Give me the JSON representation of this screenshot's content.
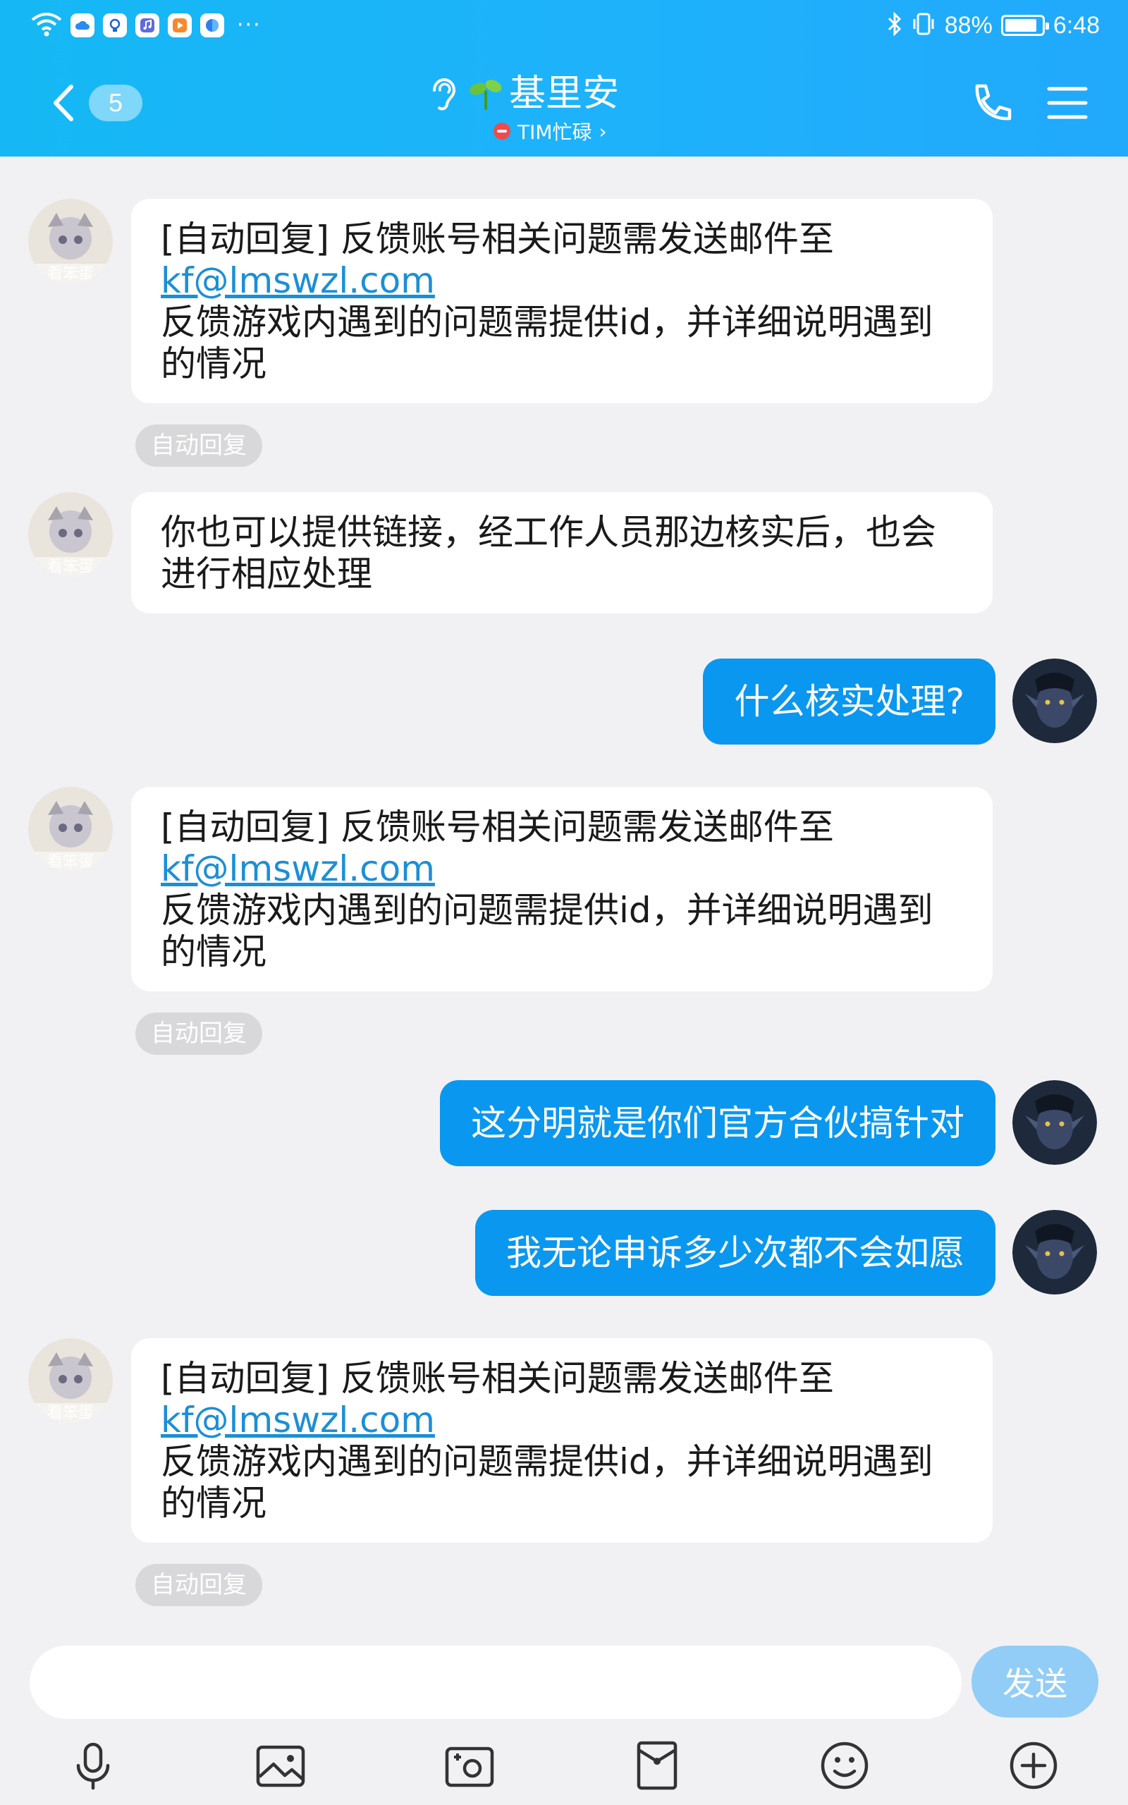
{
  "status_bar": {
    "battery": "88%",
    "time": "6:48",
    "more_dots": "···"
  },
  "header": {
    "unread_count": "5",
    "contact_name": "基里安",
    "status": "TIM忙碌",
    "status_chevron": "›"
  },
  "messages": [
    {
      "lines": [
        "[自动回复] 反馈账号相关问题需发送邮件至"
      ],
      "link": "kf@lmswzl.com",
      "lines_after": [
        "反馈游戏内遇到的问题需提供id，并详细说明遇到",
        "的情况"
      ],
      "tag": "自动回复"
    },
    {
      "lines": [
        "你也可以提供链接，经工作人员那边核实后，也会",
        "进行相应处理"
      ]
    },
    {
      "text": "什么核实处理?"
    },
    {
      "lines": [
        "[自动回复] 反馈账号相关问题需发送邮件至"
      ],
      "link": "kf@lmswzl.com",
      "lines_after": [
        "反馈游戏内遇到的问题需提供id，并详细说明遇到",
        "的情况"
      ],
      "tag": "自动回复"
    },
    {
      "text": "这分明就是你们官方合伙搞针对"
    },
    {
      "text": "我无论申诉多少次都不会如愿"
    },
    {
      "lines": [
        "[自动回复] 反馈账号相关问题需发送邮件至"
      ],
      "link": "kf@lmswzl.com",
      "lines_after": [
        "反馈游戏内遇到的问题需提供id，并详细说明遇到",
        "的情况"
      ],
      "tag": "自动回复"
    }
  ],
  "avatar_label": "看笨蛋",
  "input": {
    "placeholder": "",
    "send_label": "发送"
  },
  "toolbar": [
    "microphone-icon",
    "image-icon",
    "camera-icon",
    "red-packet-icon",
    "emoji-icon",
    "plus-icon"
  ],
  "colors": {
    "header": "#1eb2fb",
    "outgoing_bubble": "#0a97ef",
    "send_button": "#92cdf7",
    "background": "#f1f1f3"
  }
}
